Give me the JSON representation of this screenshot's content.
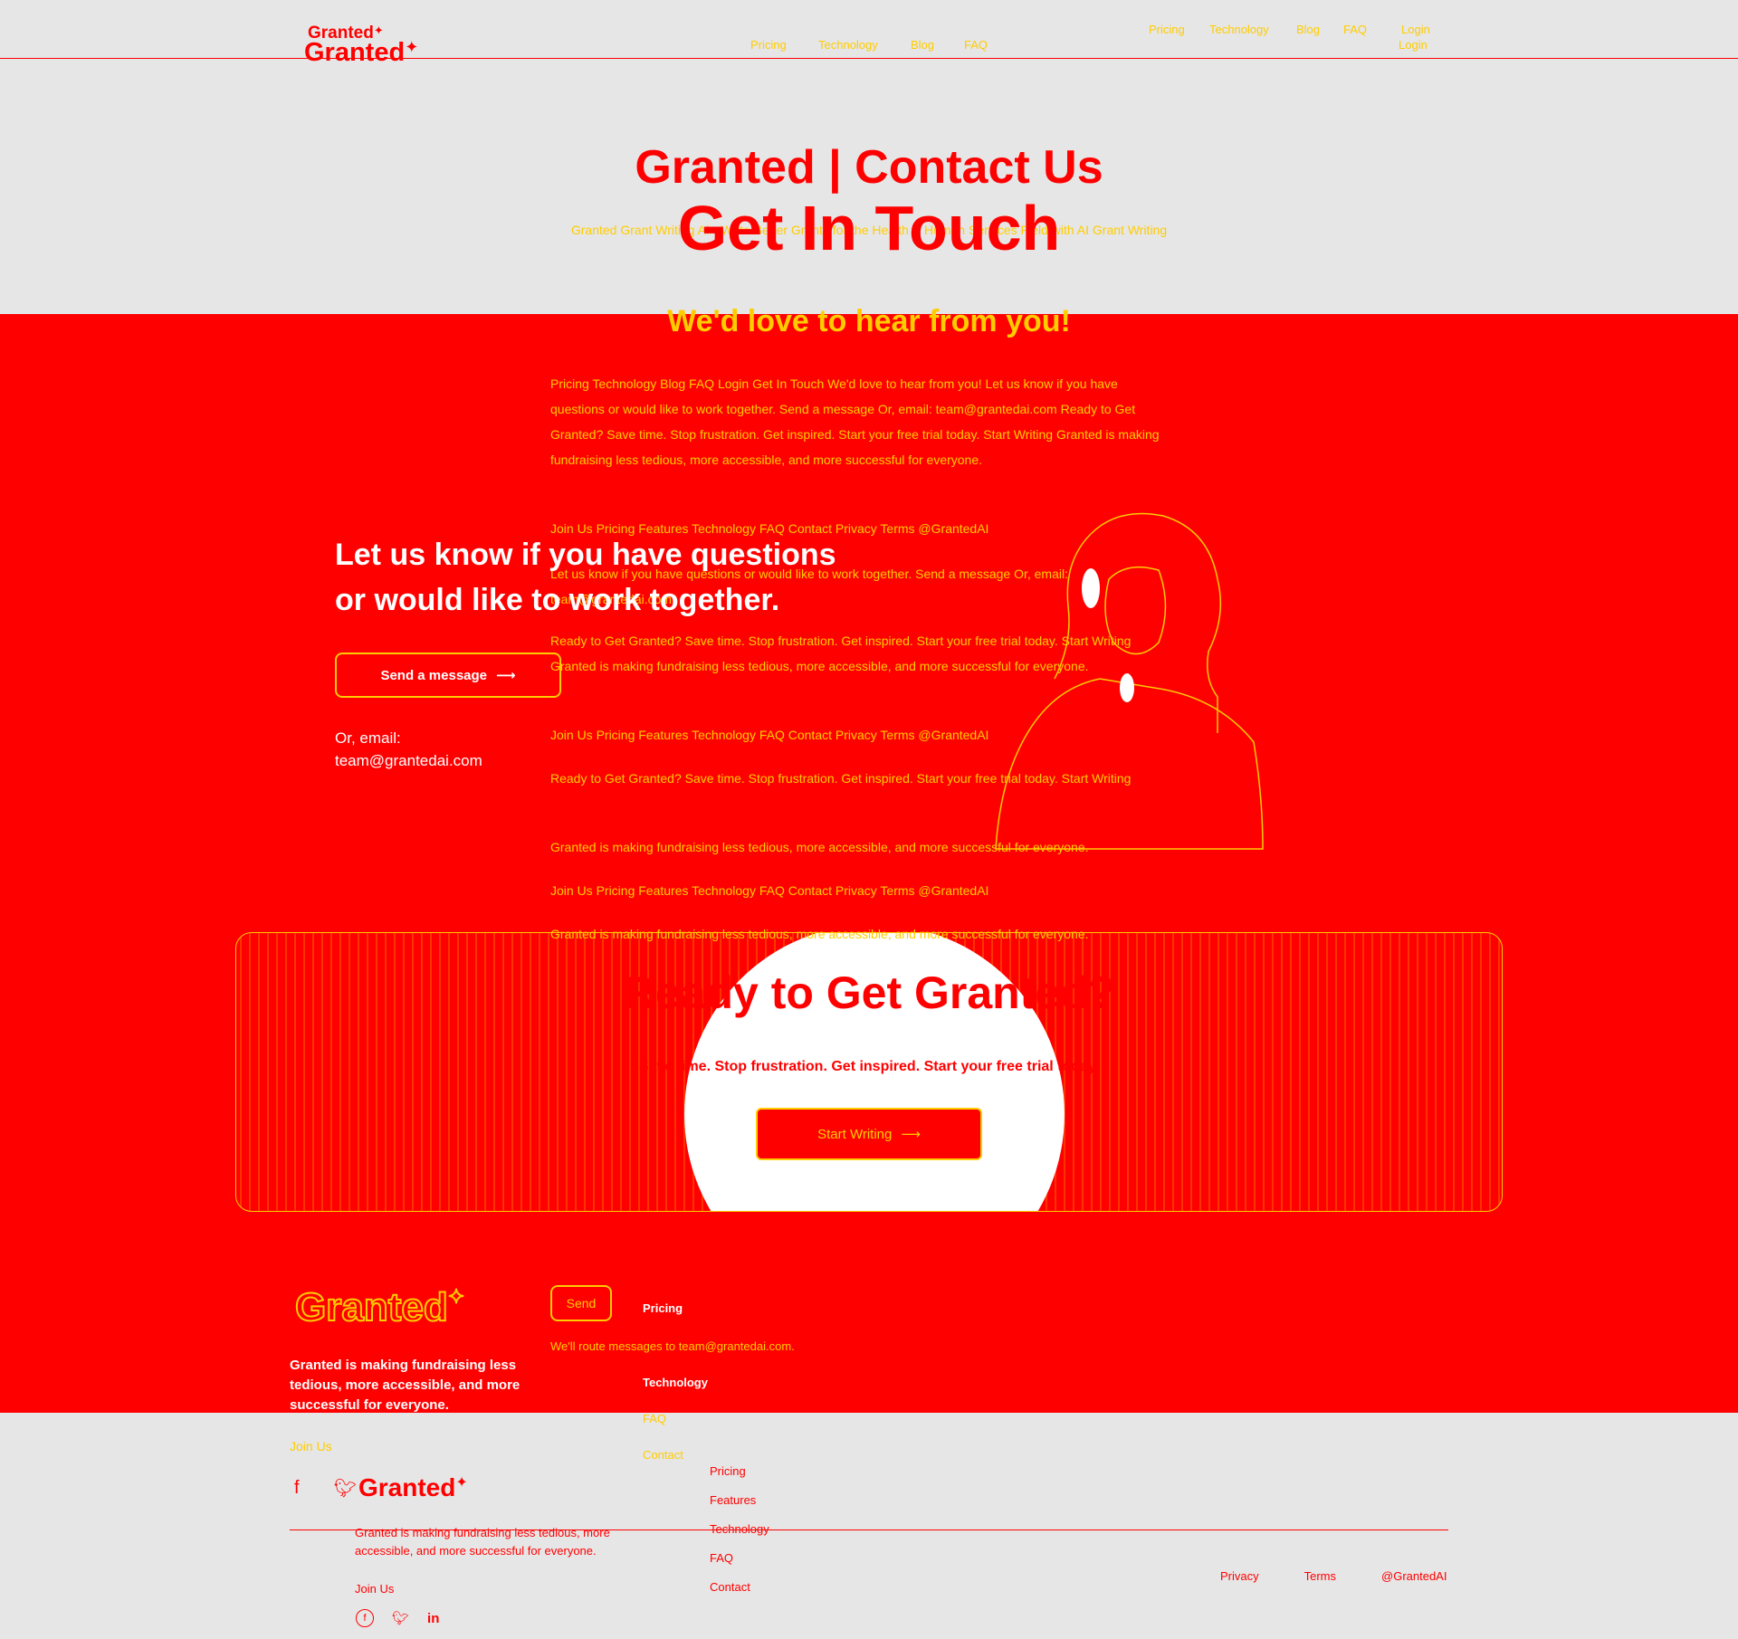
{
  "brand": {
    "name": "Granted",
    "mark": "✦"
  },
  "nav": {
    "links": [
      "Pricing",
      "Technology",
      "Blog",
      "FAQ"
    ],
    "login": "Login"
  },
  "hero": {
    "title": "Granted | Contact Us",
    "subtitle": "Granted Grant Writing AI - Write Better Grants for the Health & Human Services Field with AI Grant Writing",
    "heading": "Get In Touch",
    "tagline": "We'd love to hear from you!"
  },
  "overlay": {
    "p1": "Pricing Technology Blog FAQ Login Get In Touch We'd love to hear from you! Let us know if you have questions or would like to work together. Send a message Or, email: team@grantedai.com Ready to Get Granted? Save time. Stop frustration. Get inspired. Start your free trial today. Start Writing Granted is making fundraising less tedious, more accessible, and more successful for everyone.",
    "p2": "Join Us Pricing Features Technology FAQ Contact Privacy Terms @GrantedAI",
    "p3": "Let us know if you have questions or would like to work together. Send a message Or, email: team@grantedai.com",
    "p4": "Ready to Get Granted? Save time. Stop frustration. Get inspired. Start your free trial today. Start Writing Granted is making fundraising less tedious, more accessible, and more successful for everyone.",
    "p5": "Join Us Pricing Features Technology FAQ Contact Privacy Terms @GrantedAI",
    "p6": "Ready to Get Granted? Save time. Stop frustration. Get inspired. Start your free trial today. Start Writing",
    "p7": "Granted is making fundraising less tedious, more accessible, and more successful for everyone.",
    "p8": "Join Us Pricing Features Technology FAQ Contact Privacy Terms @GrantedAI",
    "p9": "Granted is making fundraising less tedious, more accessible, and more successful for everyone."
  },
  "contact": {
    "heading_line1": "Let us know if you have questions",
    "heading_line2": "or would like to work together.",
    "send_button": "Send a message",
    "email_label": "Or, email:",
    "email": "team@grantedai.com"
  },
  "cta": {
    "title": "Ready to Get Granted?",
    "subtitle": "Save time. Stop frustration. Get inspired. Start your free trial today.",
    "button": "Start Writing"
  },
  "form": {
    "send": "Send",
    "reply_note": "We'll route messages to team@grantedai.com."
  },
  "footer": {
    "description": "Granted is making fundraising less tedious, more accessible, and more successful for everyone.",
    "join_us": "Join Us",
    "col1": [
      "Pricing",
      "Technology",
      "FAQ",
      "Contact"
    ],
    "col2": [
      "Pricing",
      "Features",
      "Technology",
      "FAQ",
      "Contact"
    ],
    "bottom_links": [
      "Privacy",
      "Terms",
      "@GrantedAI"
    ],
    "social_icons": [
      "facebook-icon",
      "twitter-icon",
      "linkedin-icon"
    ]
  },
  "colors": {
    "primary": "#ff0000",
    "accent": "#ffcc00",
    "bg": "#e6e6e6"
  }
}
